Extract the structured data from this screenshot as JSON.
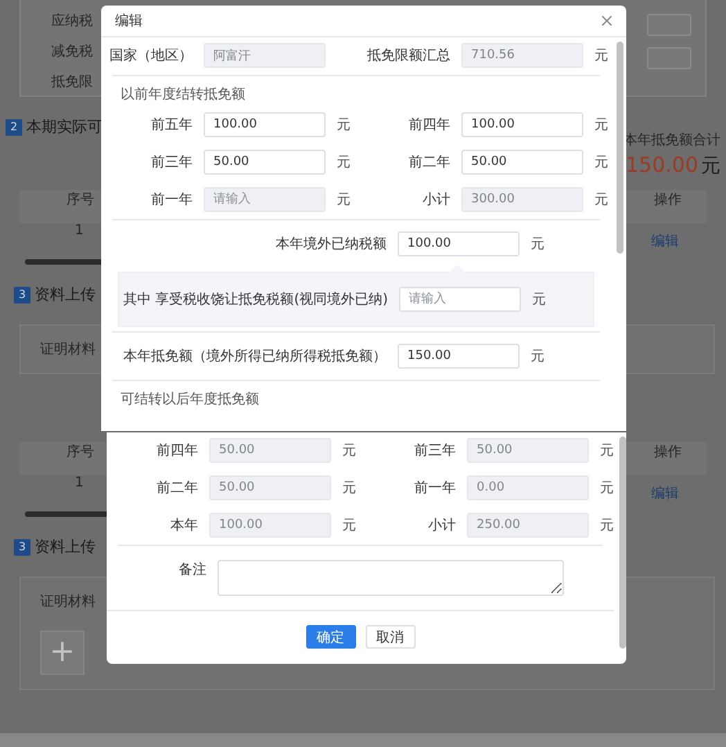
{
  "page": {
    "top_card": {
      "labels": [
        "应纳税",
        "减免税",
        "抵免限"
      ]
    },
    "section_heading": {
      "number": "2",
      "title": "本期实际可"
    },
    "total": {
      "label": "本年抵免额合计",
      "amount": "150.00",
      "unit": "元"
    },
    "parts": [
      {
        "table": {
          "columns": [
            "序号",
            "操作"
          ],
          "rows": [
            {
              "index": "1",
              "action": "编辑"
            }
          ]
        },
        "upload": {
          "number": "3",
          "title": "资料上传",
          "label": "证明材料"
        }
      },
      {
        "table": {
          "columns": [
            "序号",
            "操作"
          ],
          "rows": [
            {
              "index": "1",
              "action": "编辑"
            }
          ]
        },
        "upload": {
          "number": "3",
          "title": "资料上传",
          "label": "证明材料",
          "add_button": "+"
        }
      }
    ]
  },
  "dialogs": [
    {
      "title": "编辑",
      "sections": [
        {
          "kind": "pair",
          "fields": [
            {
              "label": "国家（地区）",
              "value": "阿富汗",
              "disabled": true
            },
            {
              "label": "抵免限额汇总",
              "value": "710.56",
              "unit": "元",
              "disabled": true
            }
          ]
        },
        {
          "kind": "divider"
        },
        {
          "kind": "heading",
          "text": "以前年度结转抵免额"
        },
        {
          "kind": "pair",
          "fields": [
            {
              "label": "前五年",
              "value": "100.00",
              "unit": "元",
              "disabled": false
            },
            {
              "label": "前四年",
              "value": "100.00",
              "unit": "元",
              "disabled": false
            }
          ]
        },
        {
          "kind": "pair",
          "fields": [
            {
              "label": "前三年",
              "value": "50.00",
              "unit": "元",
              "disabled": false
            },
            {
              "label": "前二年",
              "value": "50.00",
              "unit": "元",
              "disabled": false
            }
          ]
        },
        {
          "kind": "pair",
          "fields": [
            {
              "label": "前一年",
              "placeholder": "请输入",
              "unit": "元",
              "disabled": true
            },
            {
              "label": "小计",
              "value": "300.00",
              "unit": "元",
              "disabled": true
            }
          ]
        },
        {
          "kind": "divider"
        },
        {
          "kind": "single",
          "field": {
            "label": "本年境外已纳税额",
            "value": "100.00",
            "unit": "元",
            "disabled": false
          }
        },
        {
          "kind": "subpanel",
          "field": {
            "label": "其中 享受税收饶让抵免税额(视同境外已纳)",
            "placeholder": "请输入",
            "unit": "元",
            "disabled": false
          }
        },
        {
          "kind": "divider"
        },
        {
          "kind": "single",
          "field": {
            "label": "本年抵免额（境外所得已纳所得税抵免额）",
            "value": "150.00",
            "unit": "元",
            "disabled": false
          }
        },
        {
          "kind": "divider"
        },
        {
          "kind": "heading",
          "text": "可结转以后年度抵免额"
        }
      ]
    },
    {
      "sections": [
        {
          "kind": "pair",
          "fields": [
            {
              "label": "前四年",
              "value": "50.00",
              "unit": "元",
              "disabled": true
            },
            {
              "label": "前三年",
              "value": "50.00",
              "unit": "元",
              "disabled": true
            }
          ]
        },
        {
          "kind": "pair",
          "fields": [
            {
              "label": "前二年",
              "value": "50.00",
              "unit": "元",
              "disabled": true
            },
            {
              "label": "前一年",
              "value": "0.00",
              "unit": "元",
              "disabled": true
            }
          ]
        },
        {
          "kind": "pair",
          "fields": [
            {
              "label": "本年",
              "value": "100.00",
              "unit": "元",
              "disabled": true
            },
            {
              "label": "小计",
              "value": "250.00",
              "unit": "元",
              "disabled": true
            }
          ]
        },
        {
          "kind": "divider"
        },
        {
          "kind": "textarea",
          "label": "备注"
        }
      ],
      "buttons": [
        {
          "label": "确定",
          "kind": "primary"
        },
        {
          "label": "取消",
          "kind": "default"
        }
      ]
    }
  ]
}
